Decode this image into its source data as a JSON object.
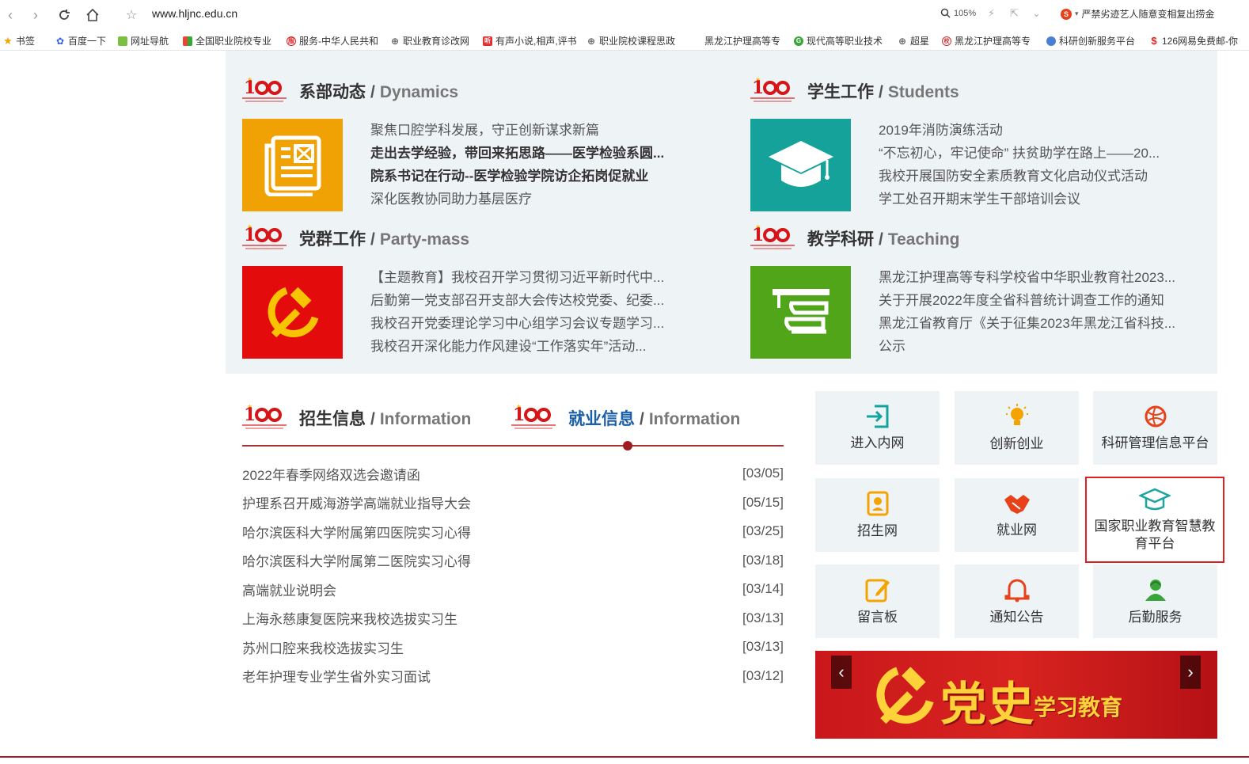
{
  "browser": {
    "url": "www.hljnc.edu.cn",
    "zoom": "105%",
    "news_ticker": "严禁劣迹艺人随意变相复出捞金",
    "bookmarks": [
      "书签",
      "百度一下",
      "网址导航",
      "全国职业院校专业",
      "服务-中华人民共和",
      "职业教育诊改网",
      "有声小说,相声,评书",
      "职业院校课程思政",
      "黑龙江护理高等专",
      "现代高等职业技术",
      "超星",
      "黑龙江护理高等专",
      "科研创新服务平台",
      "126网易免费邮-你"
    ]
  },
  "sections": {
    "dynamics": {
      "title_cn": "系部动态",
      "title_en": "Dynamics",
      "color": "#f0a204",
      "items": [
        {
          "text": "聚焦口腔学科发展，守正创新谋求新篇",
          "bold": false
        },
        {
          "text": "走出去学经验，带回来拓思路——医学检验系圆...",
          "bold": true
        },
        {
          "text": "院系书记在行动--医学检验学院访企拓岗促就业",
          "bold": true
        },
        {
          "text": "深化医教协同助力基层医疗",
          "bold": false
        }
      ]
    },
    "students": {
      "title_cn": "学生工作",
      "title_en": "Students",
      "color": "#14a29b",
      "items": [
        {
          "text": "2019年消防演练活动"
        },
        {
          "text": "“不忘初心，牢记使命” 扶贫助学在路上——20..."
        },
        {
          "text": "我校开展国防安全素质教育文化启动仪式活动"
        },
        {
          "text": "学工处召开期末学生干部培训会议"
        }
      ]
    },
    "party": {
      "title_cn": "党群工作",
      "title_en": "Party-mass",
      "color": "#e30b0b",
      "items": [
        {
          "text": "【主题教育】我校召开学习贯彻习近平新时代中..."
        },
        {
          "text": "后勤第一党支部召开支部大会传达校党委、纪委..."
        },
        {
          "text": "我校召开党委理论学习中心组学习会议专题学习..."
        },
        {
          "text": "我校召开深化能力作风建设“工作落实年”活动..."
        }
      ]
    },
    "teaching": {
      "title_cn": "教学科研",
      "title_en": "Teaching",
      "color": "#51a518",
      "items": [
        {
          "text": "黑龙江护理高等专科学校省中华职业教育社2023..."
        },
        {
          "text": "关于开展2022年度全省科普统计调查工作的通知"
        },
        {
          "text": "黑龙江省教育厅《关于征集2023年黑龙江省科技..."
        },
        {
          "text": "公示"
        }
      ]
    }
  },
  "tabs": {
    "admission": {
      "title_cn": "招生信息",
      "title_en": "Information"
    },
    "employment": {
      "title_cn": "就业信息",
      "title_en": "Information",
      "active_color": "#1a5fa8"
    }
  },
  "news": [
    {
      "title": "2022年春季网络双选会邀请函",
      "date": "[03/05]"
    },
    {
      "title": "护理系召开威海游学高端就业指导大会",
      "date": "[05/15]"
    },
    {
      "title": "哈尔滨医科大学附属第四医院实习心得",
      "date": "[03/25]"
    },
    {
      "title": "哈尔滨医科大学附属第二医院实习心得",
      "date": "[03/18]"
    },
    {
      "title": "高端就业说明会",
      "date": "[03/14]"
    },
    {
      "title": "上海永慈康复医院来我校选拔实习生",
      "date": "[03/13]"
    },
    {
      "title": "苏州口腔来我校选拔实习生",
      "date": "[03/13]"
    },
    {
      "title": "老年护理专业学生省外实习面试",
      "date": "[03/12]"
    }
  ],
  "quick_links": [
    {
      "label": "进入内网",
      "icon": "login-icon",
      "color": "#12a5a0"
    },
    {
      "label": "创新创业",
      "icon": "lightbulb-icon",
      "color": "#f5a300"
    },
    {
      "label": "科研管理信息平台",
      "icon": "globe-icon",
      "color": "#e8421a"
    },
    {
      "label": "招生网",
      "icon": "id-card-icon",
      "color": "#f5a300"
    },
    {
      "label": "就业网",
      "icon": "handshake-icon",
      "color": "#e8421a"
    },
    {
      "label": "国家职业教育智慧教育平台",
      "icon": "mortarboard-icon",
      "color": "#1aa59f"
    },
    {
      "label": "留言板",
      "icon": "edit-icon",
      "color": "#f5a300"
    },
    {
      "label": "通知公告",
      "icon": "bell-icon",
      "color": "#e8421a"
    },
    {
      "label": "后勤服务",
      "icon": "service-person-icon",
      "color": "#3aa53a"
    }
  ],
  "banner": {
    "big_text": "党史",
    "small_text": "学习教育",
    "prev": "‹",
    "next": "›"
  }
}
